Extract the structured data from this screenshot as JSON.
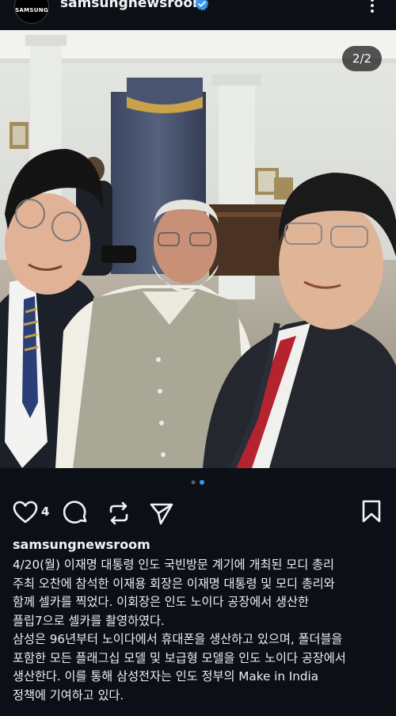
{
  "header": {
    "avatar_text": "SAMSUNG",
    "username": "samsungnewsroom",
    "verified_icon": "verified-badge-icon",
    "more_icon": "more-vertical-icon"
  },
  "post": {
    "image_counter": "2/2",
    "carousel": {
      "total": 2,
      "active": 2
    }
  },
  "actions": {
    "like_icon": "heart-icon",
    "like_count": "4",
    "comment_icon": "comment-icon",
    "repost_icon": "repost-icon",
    "share_icon": "send-icon",
    "save_icon": "bookmark-icon"
  },
  "caption": {
    "username": "samsungnewsroom",
    "lines": [
      "4/20(월) 이재명 대통령 인도 국빈방문 계기에 개최된 모디 총리",
      "주최 오찬에 참석한 이재용 회장은 이재명 대통령 및 모디 총리와",
      "함께 셀카를 찍었다. 이회장은 인도 노이다 공장에서 생산한",
      "플립7으로 셀카를 촬영하였다.",
      "삼성은 96년부터 노이다에서 휴대폰을 생산하고 있으며, 폴더블을",
      "포함한 모든 플래그십 모델 및 보급형 모델을 인도 노이다 공장에서",
      "생산한다. 이를 통해 삼성전자는 인도 정부의 Make in India",
      "정책에 기여하고 있다."
    ]
  },
  "colors": {
    "background": "#0c1016",
    "text": "#f1f2f4",
    "verified": "#3797f0",
    "active_dot": "#3797f0",
    "inactive_dot": "#5a6068"
  }
}
